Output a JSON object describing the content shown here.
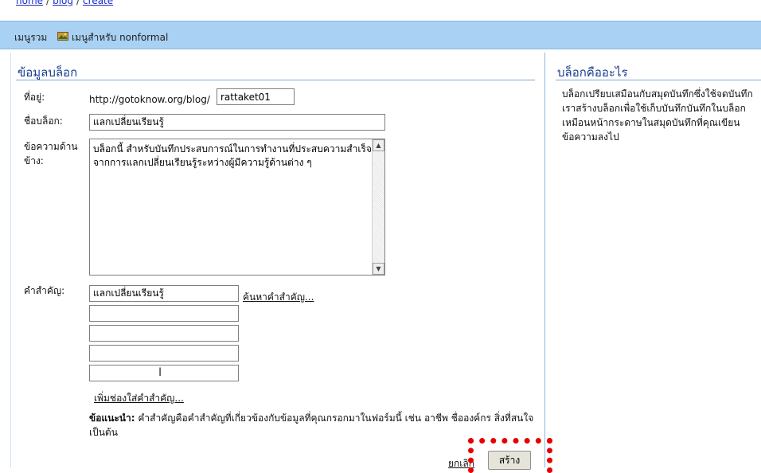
{
  "breadcrumb": {
    "items": [
      "home",
      "blog",
      "create"
    ],
    "separator": "/"
  },
  "menubar": {
    "main_menu": "เมนูรวม",
    "nonformal_menu": "เมนูสำหรับ nonformal"
  },
  "form": {
    "section_title": "ข้อมูลบล็อก",
    "address_label": "ที่อยู่:",
    "address_prefix": "http://gotoknow.org/blog/",
    "address_value": "rattaket01",
    "blog_name_label": "ชื่อบล็อก:",
    "blog_name_value": "แลกเปลี่ยนเรียนรู้",
    "side_text_label": "ข้อความด้านข้าง:",
    "side_text_value": "บล็อกนี้ สำหรับบันทึกประสบการณ์ในการทำงานที่ประสบความสำเร็จจากการแลกเปลี่ยนเรียนรู้ระหว่างผู้มีความรู้ด้านต่าง ๆ",
    "keywords_label": "คำสำคัญ:",
    "keywords": [
      "แลกเปลี่ยนเรียนรู้",
      "",
      "",
      "",
      ""
    ],
    "search_keywords_link": "ค้นหาคำสำคัญ...",
    "add_keyword_link": "เพิ่มช่องใส่คำสำคัญ...",
    "hint_label": "ข้อแนะนำ:",
    "hint_text": "คำสำคัญคือคำสำคัญที่เกี่ยวข้องกับข้อมูลที่คุณกรอกมาในฟอร์มนี้ เช่น อาชีพ ชื่อองค์กร สิ่งที่สนใจ เป็นต้น",
    "cancel_link": "ยกเลิก",
    "create_button": "สร้าง"
  },
  "sidebar": {
    "title": "บล็อกคืออะไร",
    "text": "บล็อกเปรียบเสมือนกับสมุดบันทึกซึ่งใช้จดบันทึก เราสร้างบล็อกเพื่อใช้เก็บบันทึกบันทึกในบล็อกเหมือนหน้ากระดาษในสมุดบันทึกที่คุณเขียนข้อความลงไป"
  },
  "colors": {
    "menubar": "#a9d1f3",
    "title": "#1a3d8f",
    "link": "#1a2ccc",
    "highlight": "#e80000"
  }
}
